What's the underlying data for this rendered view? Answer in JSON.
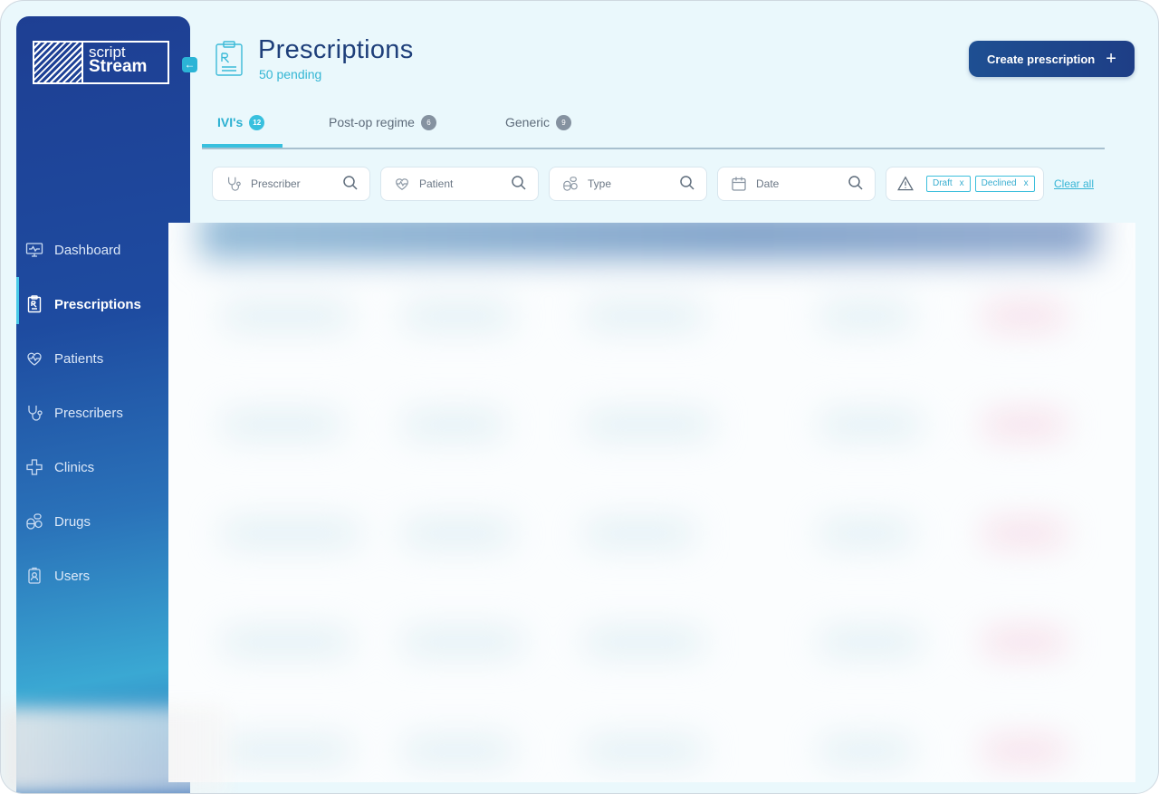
{
  "app": {
    "logo_top": "script",
    "logo_bottom": "Stream"
  },
  "sidebar": {
    "items": [
      {
        "label": "Dashboard",
        "icon": "monitor-icon",
        "active": false
      },
      {
        "label": "Prescriptions",
        "icon": "prescription-clipboard-icon",
        "active": true
      },
      {
        "label": "Patients",
        "icon": "heart-pulse-icon",
        "active": false
      },
      {
        "label": "Prescribers",
        "icon": "stethoscope-icon",
        "active": false
      },
      {
        "label": "Clinics",
        "icon": "medical-cross-icon",
        "active": false
      },
      {
        "label": "Drugs",
        "icon": "pills-icon",
        "active": false
      },
      {
        "label": "Users",
        "icon": "user-badge-icon",
        "active": false
      }
    ]
  },
  "header": {
    "title": "Prescriptions",
    "subtitle": "50 pending",
    "create_label": "Create prescription"
  },
  "tabs": [
    {
      "label": "IVI's",
      "count": "12",
      "active": true
    },
    {
      "label": "Post-op regime",
      "count": "6",
      "active": false
    },
    {
      "label": "Generic",
      "count": "9",
      "active": false
    }
  ],
  "filters": {
    "prescriber": "Prescriber",
    "patient": "Patient",
    "type": "Type",
    "date": "Date",
    "chips": [
      {
        "label": "Draft",
        "remove": "x"
      },
      {
        "label": "Declined",
        "remove": "x"
      }
    ],
    "clear_all": "Clear all"
  },
  "colors": {
    "accent": "#38c0de",
    "brand_dark": "#1e3f93",
    "page_bg": "#eaf8fc"
  }
}
